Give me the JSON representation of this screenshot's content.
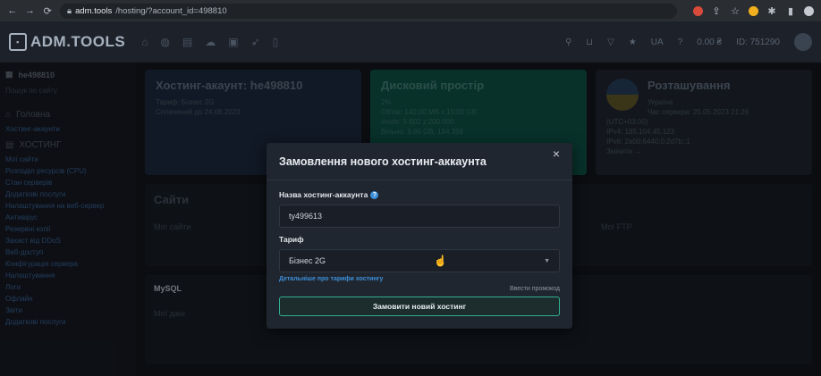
{
  "browser": {
    "url_host": "adm.tools",
    "url_path": "/hosting/?account_id=498810"
  },
  "app": {
    "logo_text": "ADM.TOOLS",
    "top_right": {
      "lang": "UA",
      "balance": "0.00 ₴",
      "id": "ID: 751290"
    }
  },
  "sidebar": {
    "user": "he498810",
    "search_placeholder": "Пошук по сайту",
    "section_label": "Головна",
    "accounts_link": "Хостинг-акаунти",
    "hosting_head": "ХОСТИНГ",
    "links": [
      "Мої сайти",
      "Розподіл ресурсів (CPU)",
      "Стан серверів",
      "Додаткові послуги",
      "Налаштування на веб-сервер",
      "Антивірус",
      "Резервні копії",
      "Захист від DDoS",
      "Веб-доступ",
      "Конфігурація сервера",
      "Налаштування",
      "Логи",
      "Офлайн",
      "Звіти",
      "Додаткові послуги"
    ]
  },
  "cards": {
    "account": {
      "title": "Хостинг-акаунт: he498810",
      "tariff": "Тариф: Бізнес 2G",
      "paid": "Сплачений до 24.06.2023"
    },
    "disk": {
      "title": "Дисковий простір",
      "line1": "Об'єм: 140.00 MB з 10.00 GB",
      "line2": "Inode: 5 602 з 200 000",
      "line3": "Вільно: 9.86 GB, 194 398",
      "percent": "2%"
    },
    "location": {
      "title": "Розташування",
      "country": "Україна",
      "server_time": "Час сервера: 25.05.2023 21:26",
      "tz": "(UTC+03:00)",
      "ipv4": "IPv4: 185.104.45.123",
      "ipv6": "IPv6: 2a00:6440:0:2d7b::1",
      "link": "Змінити →"
    }
  },
  "sections": {
    "sites": "Сайти",
    "my_sites": "Мої сайти",
    "ftp": "Мої FTP",
    "mysql": "MySQL",
    "my_db": "Мої дані"
  },
  "modal": {
    "title": "Замовлення нового хостинг-аккаунта",
    "close": "×",
    "name_label": "Назва хостинг-аккаунта",
    "name_value": "ty499613",
    "tariff_label": "Тариф",
    "tariff_value": "Бізнес 2G",
    "tariff_link": "Детальніше про тарифи хостингу",
    "promo": "Ввести промокод",
    "submit": "Замовити новий хостинг"
  }
}
